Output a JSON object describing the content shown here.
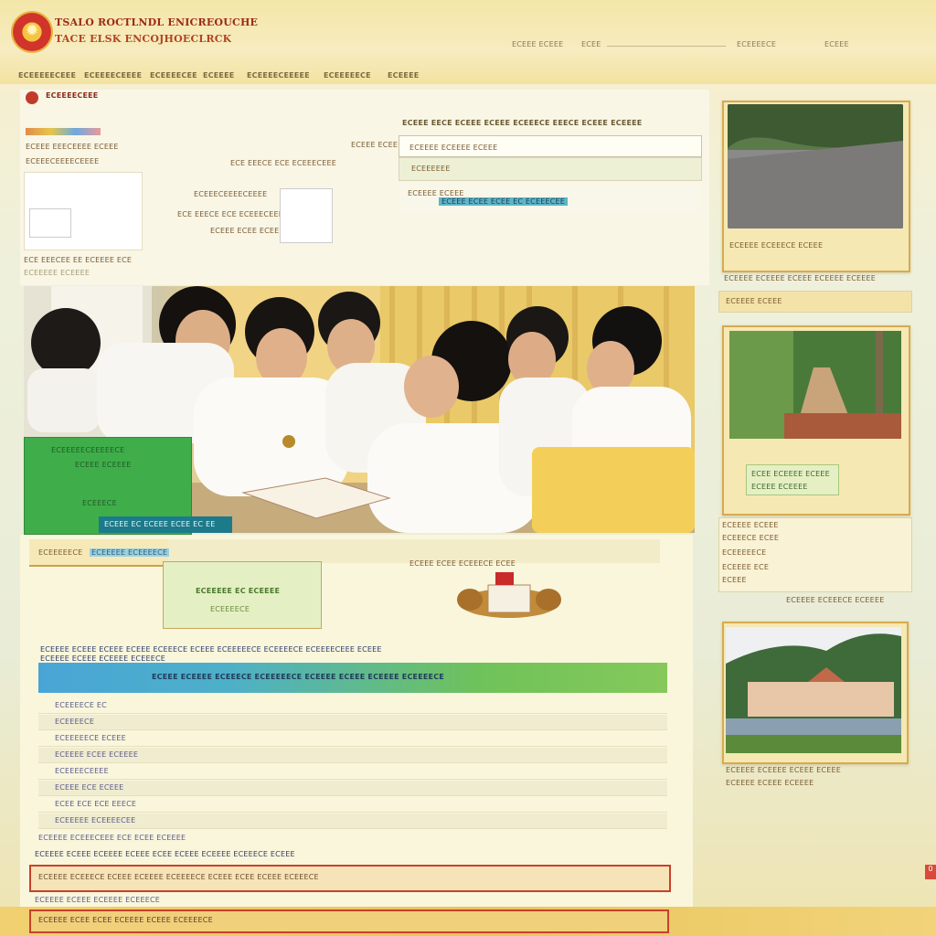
{
  "header": {
    "title_line1": "TSALO ROCTLNDL ENICREOUCHE",
    "title_line2": "TACE ELSK ENCOJHOECLRCK",
    "links": [
      "ECEEE ECEEE",
      "ECEE",
      "ECEEEECE",
      "ECEEE"
    ],
    "nav": [
      "ECEEEEECEEE",
      "ECEEEECEEEE",
      "ECEEEECEE",
      "ECEEEE",
      "ECEEEECEEEEE",
      "ECEEEEECE",
      "ECEEEE"
    ]
  },
  "top": {
    "breadcrumb": "ECEEEECEEE",
    "lines": [
      "ECEEE EEECEEEE ECEEE",
      "ECEEECEEEECEEEE",
      "ECE EEECE ECE ECEEECEEE",
      "ECEEE ECEE ECEEEE"
    ],
    "form_title": "ECEEE EECE ECEEE ECEEE ECEEECE EEECE ECEEE ECEEEE",
    "form_field1": "ECEEEE ECEEEE ECEEE",
    "form_field2": "ECEEEEEE",
    "form_field3": "ECEEEE ECEEE",
    "form_link": "ECEEE ECEE ECEE EC ECEEECEE",
    "caption1": "ECE EEECEE EE ECEEEE ECE",
    "caption2": "ECEEEEE ECEEEE"
  },
  "photo": {
    "green_box_lines": [
      "ECEEEEECEEEEECE",
      "ECEEE ECEEEE",
      "ECEEECE"
    ],
    "blue_bar_text": "ECEEE EC ECEEE ECEE EC EE"
  },
  "mid": {
    "tab": "ECEEEEE ECEEEECE",
    "tab_title": "ECEEEEECE",
    "card_line1": "ECEEEEE EC ECEEEE",
    "card_line2": "ECEEEECE",
    "emblem_caption": "ECEEE ECEE ECEEECE ECEE",
    "intro": "ECEEEE ECEEE ECEEE ECEEE ECEEECE ECEEE ECEEEEECE ECEEEECE ECEEEECEEE ECEEE",
    "banner": "ECEEE ECEEEE ECEEECE ECEEEEECE ECEEEE ECEEE ECEEEE ECEEEECE",
    "list": [
      "ECEEEECE EC",
      "ECEEEECE",
      "ECEEEEECE ECEEE",
      "ECEEEE ECEE ECEEEE",
      "ECEEEECEEEE",
      "ECEEE ECE ECEEE",
      "ECEE ECE ECE EEECE",
      "ECEEEEE ECEEEECEE"
    ],
    "note1": "ECEEEE ECEEECEEE ECE ECEE ECEEEE",
    "note2": "ECEEEE ECEEE ECEEEE ECEEE ECEE ECEEE ECEEEE ECEEECE ECEEE",
    "highlight1": "ECEEEE ECEEECE ECEEE ECEEEE ECEEEECE ECEEE ECEE ECEEE ECEEECE",
    "note3": "ECEEEE ECEEE ECEEEE ECEEECE",
    "highlight2": "ECEEEE ECEE ECEE ECEEEE ECEEE ECEEEECE"
  },
  "sidebar": {
    "card1_caption": "ECEEEE ECEEECE ECEEE",
    "item1": "ECEEEE ECEEEE ECEEE ECEEEE ECEEEE",
    "item2": "ECEEEE ECEEE",
    "badge_line1": "ECEE ECEEEE ECEEE",
    "badge_line2": "ECEEE ECEEEE",
    "links": [
      "ECEEEE ECEEE",
      "ECEEECE ECEE",
      "ECEEEEECE",
      "ECEEEE ECE",
      "ECEEE"
    ],
    "more": "ECEEEE ECEEECE ECEEEE",
    "card3_line1": "ECEEEE ECEEEE ECEEE ECEEE",
    "card3_line2": "ECEEEE ECEEE ECEEEE"
  },
  "corner_button": "0"
}
